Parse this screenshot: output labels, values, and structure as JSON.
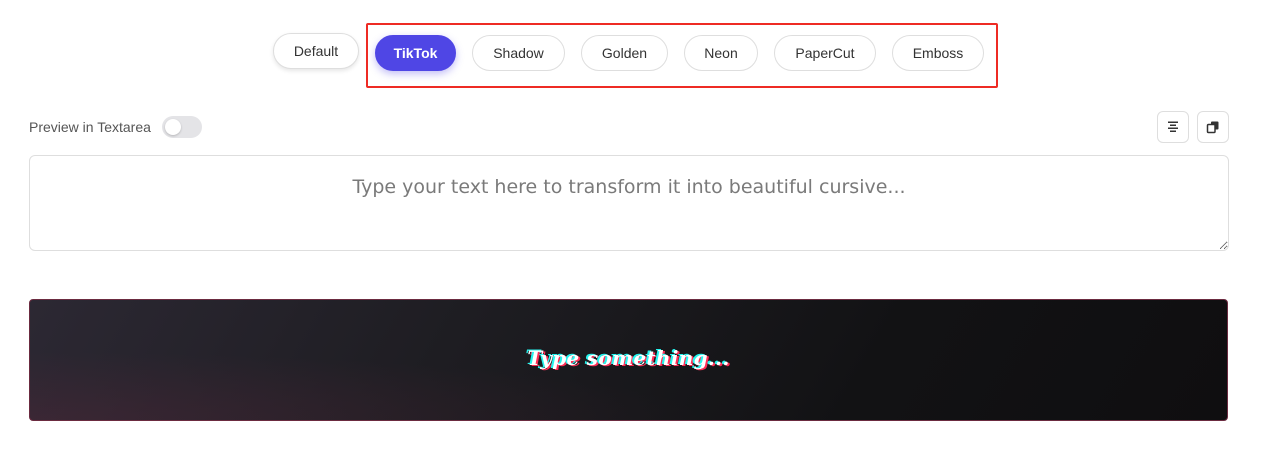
{
  "styles": [
    {
      "label": "Default",
      "active": false
    },
    {
      "label": "TikTok",
      "active": true
    },
    {
      "label": "Shadow",
      "active": false
    },
    {
      "label": "Golden",
      "active": false
    },
    {
      "label": "Neon",
      "active": false
    },
    {
      "label": "PaperCut",
      "active": false
    },
    {
      "label": "Emboss",
      "active": false
    }
  ],
  "preview_toggle": {
    "label": "Preview in Textarea",
    "on": false
  },
  "toolbar": {
    "align_icon": "align-center-icon",
    "copy_icon": "copy-icon"
  },
  "input": {
    "value": "",
    "placeholder": "Type your text here to transform it into beautiful cursive..."
  },
  "preview": {
    "text": "Type something...",
    "style": "TikTok"
  },
  "colors": {
    "accent": "#4f46e5",
    "highlight_border": "#ee2b24",
    "tiktok_cyan": "#25f4ee",
    "tiktok_pink": "#fe2c55"
  }
}
